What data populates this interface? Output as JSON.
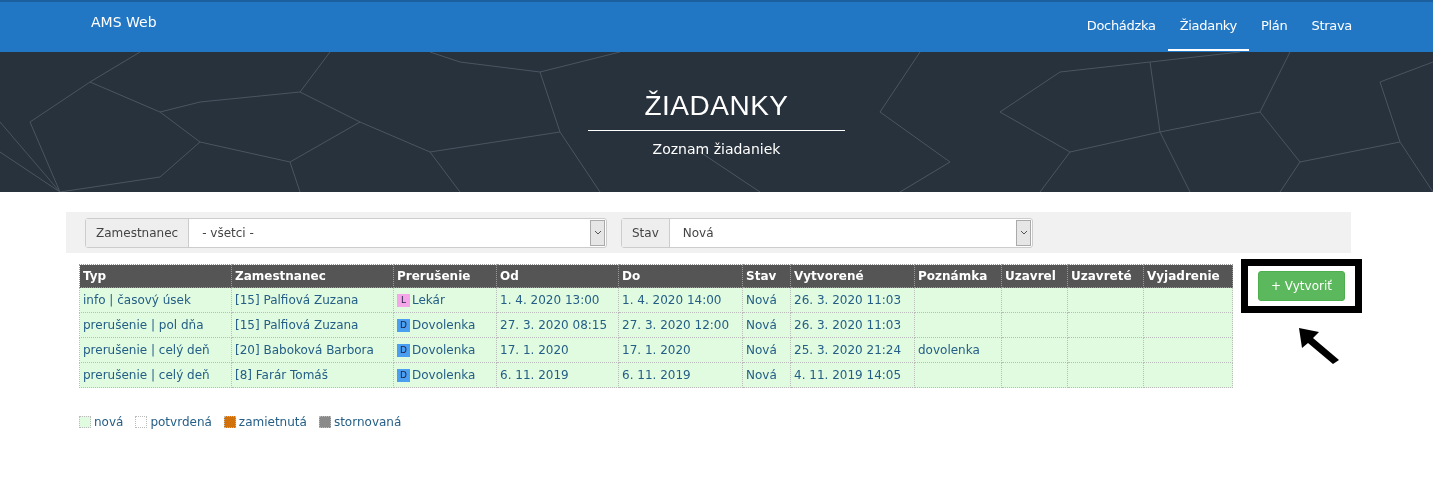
{
  "navbar": {
    "brand": "AMS Web",
    "items": [
      {
        "label": "Dochádzka",
        "selected": false
      },
      {
        "label": "Žiadanky",
        "selected": true
      },
      {
        "label": "Plán",
        "selected": false
      },
      {
        "label": "Strava",
        "selected": false
      }
    ]
  },
  "hero": {
    "title": "ŽIADANKY",
    "subtitle": "Zoznam žiadaniek"
  },
  "filters": [
    {
      "label": "Zamestnanec",
      "value": "- všetci -"
    },
    {
      "label": "Stav",
      "value": "Nová"
    }
  ],
  "table": {
    "columns": [
      "Typ",
      "Zamestnanec",
      "Prerušenie",
      "Od",
      "Do",
      "Stav",
      "Vytvorené",
      "Poznámka",
      "Uzavrel",
      "Uzavreté",
      "Vyjadrenie"
    ],
    "rows": [
      {
        "cells": [
          "info | časový úsek",
          "[15] Palfiová Zuzana",
          "Lekár",
          "1. 4. 2020 13:00",
          "1. 4. 2020 14:00",
          "Nová",
          "26. 3. 2020 11:03",
          "",
          "",
          "",
          ""
        ],
        "badge": {
          "letter": "L",
          "color": "#f4a6e8"
        }
      },
      {
        "cells": [
          "prerušenie | pol dňa",
          "[15] Palfiová Zuzana",
          "Dovolenka",
          "27. 3. 2020 08:15",
          "27. 3. 2020 12:00",
          "Nová",
          "26. 3. 2020 11:03",
          "",
          "",
          "",
          ""
        ],
        "badge": {
          "letter": "D",
          "color": "#4a9ff0"
        }
      },
      {
        "cells": [
          "prerušenie | celý deň",
          "[20] Baboková Barbora",
          "Dovolenka",
          "17. 1. 2020",
          "17. 1. 2020",
          "Nová",
          "25. 3. 2020 21:24",
          "dovolenka",
          "",
          "",
          ""
        ],
        "badge": {
          "letter": "D",
          "color": "#4a9ff0"
        }
      },
      {
        "cells": [
          "prerušenie | celý deň",
          "[8] Farár Tomáš",
          "Dovolenka",
          "6. 11. 2019",
          "6. 11. 2019",
          "Nová",
          "4. 11. 2019 14:05",
          "",
          "",
          "",
          ""
        ],
        "badge": {
          "letter": "D",
          "color": "#4a9ff0"
        }
      }
    ]
  },
  "create_button": {
    "icon": "+",
    "label": "Vytvoriť"
  },
  "legend": [
    {
      "label": "nová",
      "color": "#e0fbe0"
    },
    {
      "label": "potvrdená",
      "color": "#ffffff"
    },
    {
      "label": "zamietnutá",
      "color": "#d2700a"
    },
    {
      "label": "stornovaná",
      "color": "#8a8a8a"
    }
  ]
}
